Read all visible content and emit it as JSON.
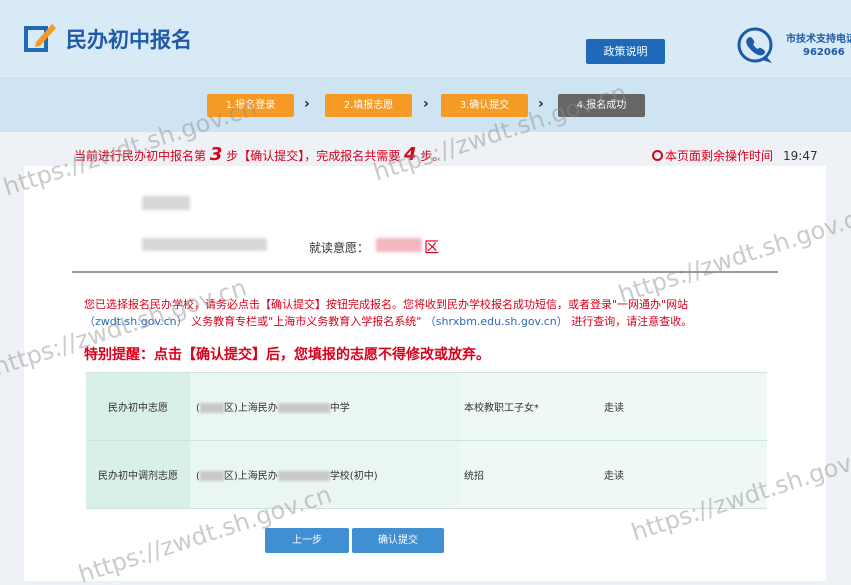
{
  "header": {
    "title": "民办初中报名",
    "policy_button": "政策说明",
    "support_label": "市技术支持电话",
    "support_number": "962066"
  },
  "steps": [
    {
      "label": "1.报名登录",
      "state": "done"
    },
    {
      "label": "2.填报志愿",
      "state": "done"
    },
    {
      "label": "3.确认提交",
      "state": "current"
    },
    {
      "label": "4.报名成功",
      "state": "pending"
    }
  ],
  "status": {
    "prefix": "当前进行民办初中报名第",
    "current_step": "3",
    "middle": "步【确认提交】，完成报名共需要",
    "total_steps": "4",
    "suffix": "步。",
    "timer_label": "本页面剩余操作时间",
    "timer_value": "19:47"
  },
  "applicant": {
    "intent_label": "就读意愿：",
    "intent_district": "区"
  },
  "notice": {
    "line1": "您已选择报名民办学校，请务必点击【确认提交】按钮完成报名。您将收到民办学校报名成功短信，或者登录\"一网通办\"网站",
    "link1": "（zwdt.sh.gov.cn）",
    "line2a": "义务教育专栏或\"上海市义务教育入学报名系统\"",
    "link2": "（shrxbm.edu.sh.gov.cn）",
    "line2b": "进行查询，请注意查收。"
  },
  "warning": "特别提醒：点击【确认提交】后，您填报的志愿不得修改或放弃。",
  "choices": [
    {
      "type": "民办初中志愿",
      "school_a": "区)上海民办",
      "school_b": "中学",
      "category": "本校教职工子女*",
      "mode": "走读"
    },
    {
      "type": "民办初中调剂志愿",
      "school_a": "区)上海民办",
      "school_b": "学校(初中)",
      "category": "统招",
      "mode": "走读"
    }
  ],
  "buttons": {
    "prev": "上一步",
    "confirm": "确认提交"
  },
  "watermark": "https://zwdt.sh.gov.cn"
}
